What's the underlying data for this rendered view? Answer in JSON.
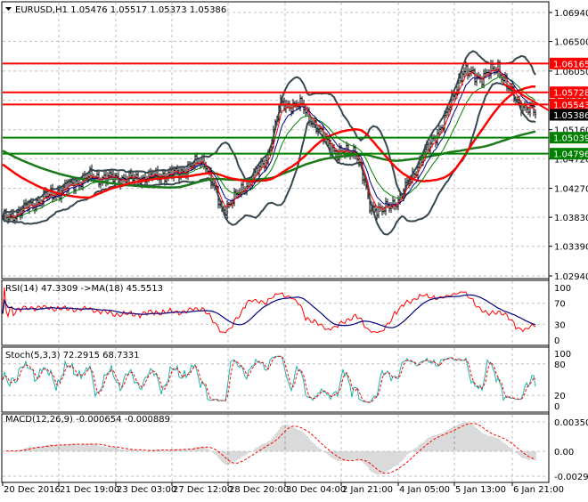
{
  "header": {
    "symbol": "EURUSD,H1",
    "open": "1.05476",
    "high": "1.05517",
    "low": "1.05373",
    "close": "1.05386"
  },
  "colors": {
    "support": "#008000",
    "resistance": "#ff0000",
    "bars": "#000000",
    "bands": "#37474f",
    "current": "#000000"
  },
  "chart_data": [
    {
      "type": "line",
      "title": "EURUSD,H1",
      "ylim": [
        1.0294,
        1.0694
      ],
      "y_ticks": [
        "1.06940",
        "1.06500",
        "1.06050",
        "1.05610",
        "1.05160",
        "1.04720",
        "1.04270",
        "1.03830",
        "1.03390",
        "1.02940"
      ],
      "x_ticks": [
        "20 Dec 2016",
        "21 Dec 19:00",
        "23 Dec 03:00",
        "27 Dec 12:00",
        "28 Dec 20:00",
        "30 Dec 04:00",
        "2 Jan 21:00",
        "4 Jan 05:00",
        "5 Jan 13:00",
        "6 Jan 21:00"
      ],
      "price_keypoints": [
        [
          0,
          1.0378
        ],
        [
          18,
          1.0405
        ],
        [
          48,
          1.0444
        ],
        [
          74,
          1.0441
        ],
        [
          98,
          1.045
        ],
        [
          113,
          1.047
        ],
        [
          123,
          1.0393
        ],
        [
          133,
          1.042
        ],
        [
          148,
          1.047
        ],
        [
          156,
          1.0555
        ],
        [
          168,
          1.0552
        ],
        [
          178,
          1.0512
        ],
        [
          188,
          1.0478
        ],
        [
          198,
          1.0485
        ],
        [
          206,
          1.0402
        ],
        [
          213,
          1.0392
        ],
        [
          223,
          1.0412
        ],
        [
          233,
          1.0462
        ],
        [
          248,
          1.053
        ],
        [
          258,
          1.0605
        ],
        [
          268,
          1.0595
        ],
        [
          278,
          1.061
        ],
        [
          288,
          1.056
        ],
        [
          300,
          1.0539
        ]
      ],
      "levels": [
        {
          "label": "1.06165",
          "value": 1.06165,
          "kind": "resistance"
        },
        {
          "label": "1.05728",
          "value": 1.05728,
          "kind": "resistance"
        },
        {
          "label": "1.05543",
          "value": 1.05543,
          "kind": "resistance"
        },
        {
          "label": "1.05386",
          "value": 1.05386,
          "kind": "current"
        },
        {
          "label": "1.05039",
          "value": 1.05039,
          "kind": "support"
        },
        {
          "label": "1.04796",
          "value": 1.04796,
          "kind": "support"
        }
      ]
    },
    {
      "type": "line",
      "title": "RSI(14) 47.3309  ->MA(18) 45.5513",
      "ylim": [
        0,
        100
      ],
      "y_ticks": [
        "100",
        "70",
        "30",
        "0"
      ],
      "rsi": 47.3309,
      "ma": 45.5513
    },
    {
      "type": "line",
      "title": "Stoch(5,3,3) 72.2915 68.7331",
      "ylim": [
        0,
        100
      ],
      "y_ticks": [
        "100",
        "80",
        "20",
        "0"
      ],
      "main": 72.2915,
      "signal": 68.7331
    },
    {
      "type": "bar",
      "title": "MACD(12,26,9) -0.000654 -0.000889",
      "ylim": [
        -0.002938,
        0.003502
      ],
      "y_ticks": [
        "0.003502",
        "0.00",
        "-0.002938"
      ],
      "macd": -0.000654,
      "signal": -0.000889
    }
  ]
}
